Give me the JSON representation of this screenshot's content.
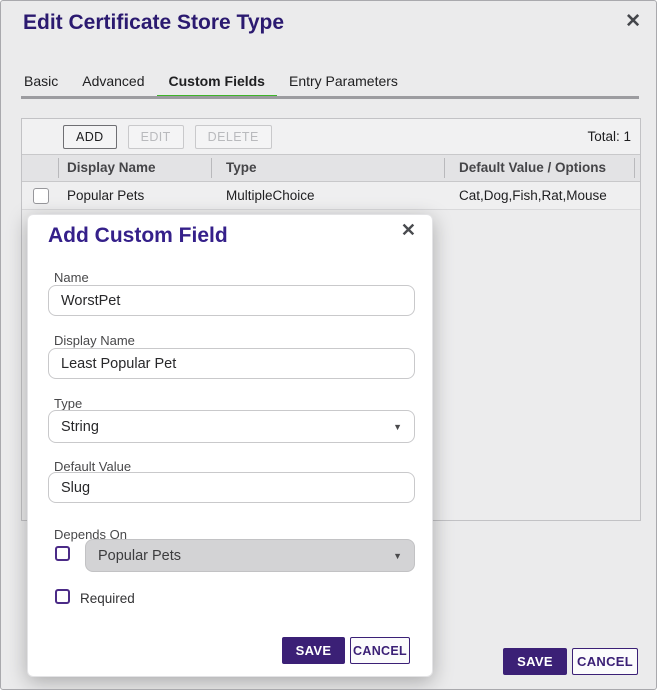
{
  "icons": {
    "close": "✕",
    "dropdown": "▼"
  },
  "colors": {
    "brand_purple": "#3b2076",
    "title_purple": "#2b1a70",
    "modal_title_purple": "#35208a",
    "active_tab_green": "#3eb42a",
    "checkbox_purple": "#4b2b87",
    "disabled_gray": "#d3d3d5"
  },
  "window": {
    "title": "Edit Certificate Store Type"
  },
  "tabs": [
    {
      "label": "Basic",
      "active": false
    },
    {
      "label": "Advanced",
      "active": false
    },
    {
      "label": "Custom Fields",
      "active": true
    },
    {
      "label": "Entry Parameters",
      "active": false
    }
  ],
  "table_panel": {
    "toolbar": {
      "add_label": "ADD",
      "edit_label": "EDIT",
      "delete_label": "DELETE",
      "total_label": "Total: 1"
    },
    "columns": [
      "Display Name",
      "Type",
      "Default Value / Options"
    ],
    "rows": [
      {
        "checked": false,
        "display_name": "Popular Pets",
        "type": "MultipleChoice",
        "default_value": "Cat,Dog,Fish,Rat,Mouse"
      }
    ]
  },
  "modal": {
    "title": "Add Custom Field",
    "fields": {
      "name": {
        "label": "Name",
        "value": "WorstPet"
      },
      "display_name": {
        "label": "Display Name",
        "value": "Least Popular Pet"
      },
      "type": {
        "label": "Type",
        "value": "String"
      },
      "default_value": {
        "label": "Default Value",
        "value": "Slug"
      },
      "depends_on": {
        "label": "Depends On",
        "value": "Popular Pets",
        "checked": false,
        "disabled": true
      },
      "required": {
        "label": "Required",
        "checked": false
      }
    },
    "save_label": "SAVE",
    "cancel_label": "CANCEL"
  },
  "footer": {
    "save_label": "SAVE",
    "cancel_label": "CANCEL"
  }
}
